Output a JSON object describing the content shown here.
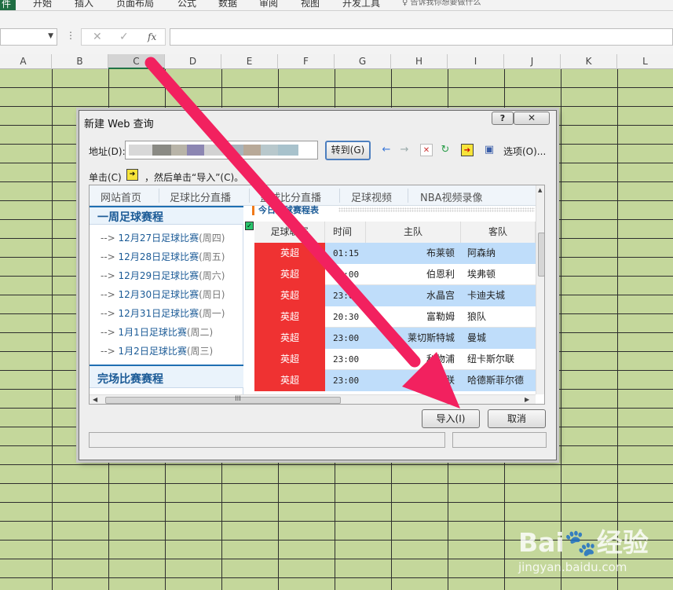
{
  "ribbon": {
    "file_tab": "件",
    "tabs": [
      "开始",
      "插入",
      "页面布局",
      "公式",
      "数据",
      "审阅",
      "视图",
      "开发工具"
    ],
    "hint": "♀ 告诉我你想要做什么"
  },
  "formula_bar": {
    "fx": "fx",
    "cancel": "✕",
    "enter": "✓",
    "dots": "⋮"
  },
  "sheet": {
    "columns": [
      "A",
      "B",
      "C",
      "D",
      "E",
      "F",
      "G",
      "H",
      "I",
      "J",
      "K",
      "L"
    ],
    "active_column": "C",
    "fill_color": "#c4d79b"
  },
  "dialog": {
    "title": "新建 Web 查询",
    "help": "?",
    "close": "✕",
    "address_label": "地址(D):",
    "go_label": "转到(G)",
    "options_label": "选项(O)...",
    "hint_before": "单击(C)",
    "hint_icon": "➔",
    "hint_after": "，然后单击“导入”(C)。",
    "import_label": "导入(I)",
    "cancel_label": "取消",
    "site": {
      "nav": [
        "网站首页",
        "足球比分直播",
        "篮球比分直播",
        "足球视频",
        "NBA视频录像"
      ],
      "left_heading": "一周足球赛程",
      "links": [
        {
          "arrow": "-->",
          "text": "12月27日足球比赛",
          "week": "(周四)"
        },
        {
          "arrow": "-->",
          "text": "12月28日足球比赛",
          "week": "(周五)"
        },
        {
          "arrow": "-->",
          "text": "12月29日足球比赛",
          "week": "(周六)"
        },
        {
          "arrow": "-->",
          "text": "12月30日足球比赛",
          "week": "(周日)"
        },
        {
          "arrow": "-->",
          "text": "12月31日足球比赛",
          "week": "(周一)"
        },
        {
          "arrow": "-->",
          "text": "1月1日足球比赛",
          "week": "(周二)"
        },
        {
          "arrow": "-->",
          "text": "1月2日足球比赛",
          "week": "(周三)"
        }
      ],
      "left_heading2": "完场比赛赛程",
      "table_title": "今日足球赛程表",
      "headers": [
        "足球联赛",
        "时间",
        "主队",
        "客队"
      ],
      "rows": [
        {
          "league": "英超",
          "time": "01:15",
          "home": "布莱顿",
          "away": "阿森纳"
        },
        {
          "league": "英超",
          "time": "23:00",
          "home": "伯恩利",
          "away": "埃弗顿"
        },
        {
          "league": "英超",
          "time": "23:00",
          "home": "水晶宫",
          "away": "卡迪夫城"
        },
        {
          "league": "英超",
          "time": "20:30",
          "home": "富勒姆",
          "away": "狼队"
        },
        {
          "league": "英超",
          "time": "23:00",
          "home": "莱切斯特城",
          "away": "曼城"
        },
        {
          "league": "英超",
          "time": "23:00",
          "home": "利物浦",
          "away": "纽卡斯尔联"
        },
        {
          "league": "英超",
          "time": "23:00",
          "home": "曼联",
          "away": "哈德斯菲尔德"
        }
      ],
      "hscroll_grip": "III"
    }
  },
  "watermark": {
    "logo": "Bai🐾经验",
    "url": "jingyan.baidu.com"
  },
  "colors": {
    "sheet_fill": "#c4d79b",
    "league_red": "#ef3232",
    "row_blue": "#bfddfa",
    "arrow_pink": "#f2215f",
    "excel_green": "#1f6e43"
  }
}
